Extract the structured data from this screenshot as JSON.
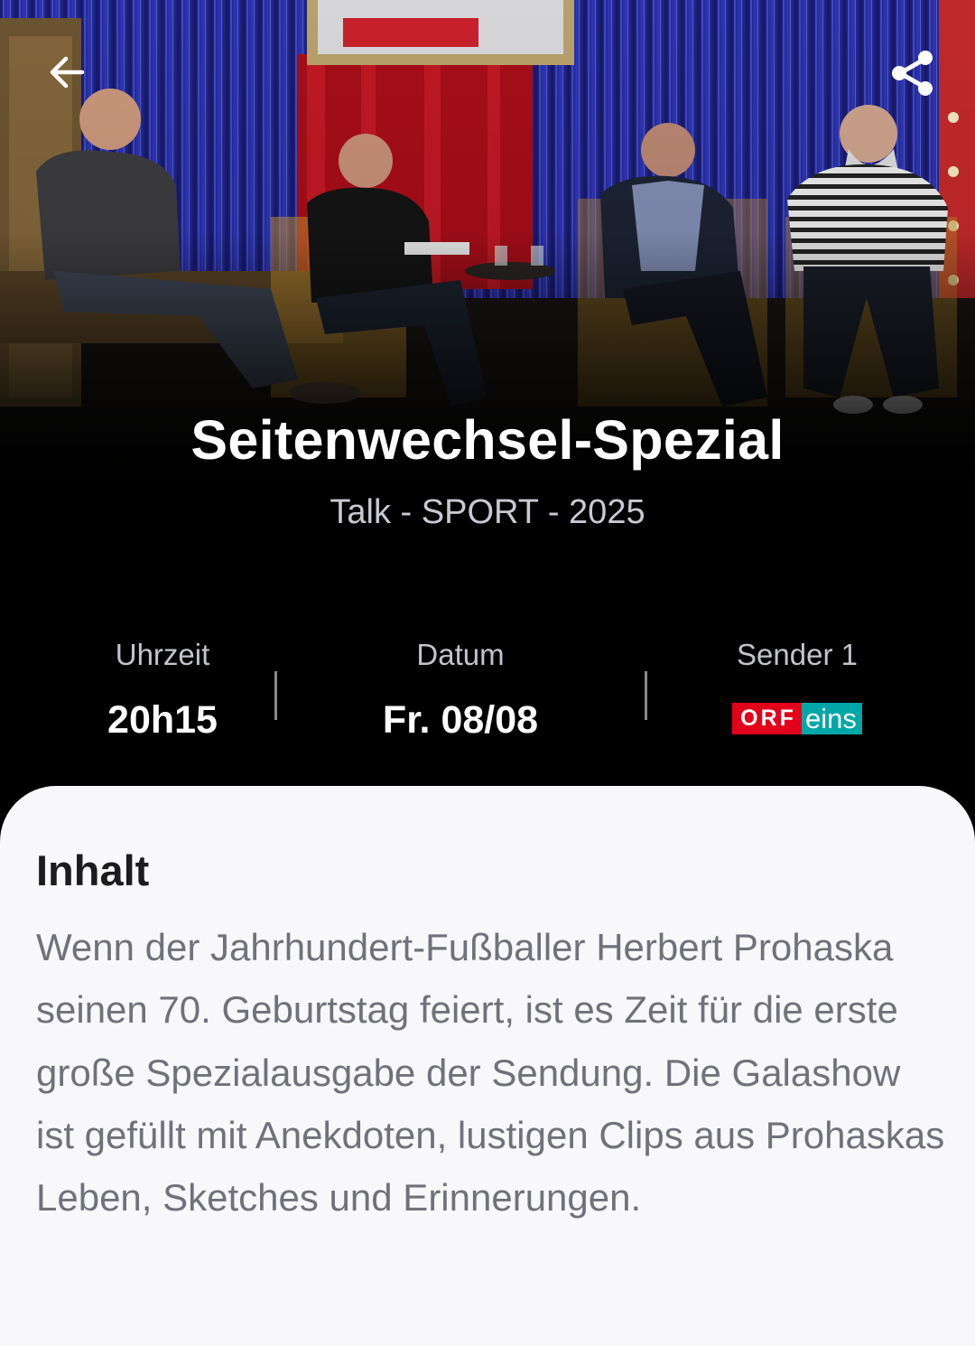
{
  "navigation": {
    "back_icon": "arrow-left-icon",
    "share_icon": "share-icon"
  },
  "show": {
    "title": "Seitenwechsel-Spezial",
    "meta": "Talk - SPORT - 2025"
  },
  "info": {
    "time_label": "Uhrzeit",
    "time_value": "20h15",
    "date_label": "Datum",
    "date_value": "Fr. 08/08",
    "channel_label": "Sender 1",
    "channel_logo": {
      "left_text": "ORF",
      "right_text": "eins",
      "left_color": "#e2001a",
      "right_color": "#00a7a6"
    }
  },
  "content": {
    "heading": "Inhalt",
    "description": "Wenn der Jahrhundert-Fußballer Herbert Prohaska seinen 70. Geburtstag feiert, ist es Zeit für die erste große Spezialausgabe der Sendung. Die Galashow ist gefüllt mit Anekdoten, lustigen Clips aus Prohaskas Leben, Sketches und Erinnerungen."
  },
  "colors": {
    "background": "#000000",
    "card_background": "#f8f8fb",
    "curtain_blue": "#2a2ea8",
    "curtain_red": "#b0101c"
  }
}
